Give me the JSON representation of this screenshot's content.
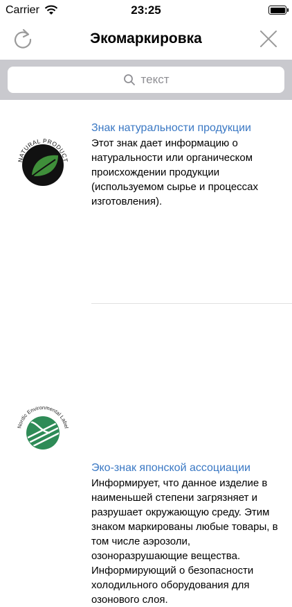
{
  "status": {
    "carrier": "Carrier",
    "time": "23:25"
  },
  "nav": {
    "title": "Экомаркировка"
  },
  "search": {
    "placeholder": "текст"
  },
  "items": [
    {
      "title": "Знак натуральности продукции",
      "description": "Этот знак дает информацию о натуральности или органическом происхождении продукции (используемом сырье и процессах изготовления).",
      "logo_text": "NATURAL PRODUCT"
    },
    {
      "title": "Эко-знак японской ассоциации",
      "description": "Информирует, что данное изделие в наименьшей степени загрязняет и разрушает окружающую среду. Этим знаком маркированы любые товары, в том числе аэрозоли, озоноразрушающие вещества. Информирующий о безопасности холодильного оборудования для озонового слоя.",
      "logo_text": "Nordic Environmental Label"
    }
  ]
}
